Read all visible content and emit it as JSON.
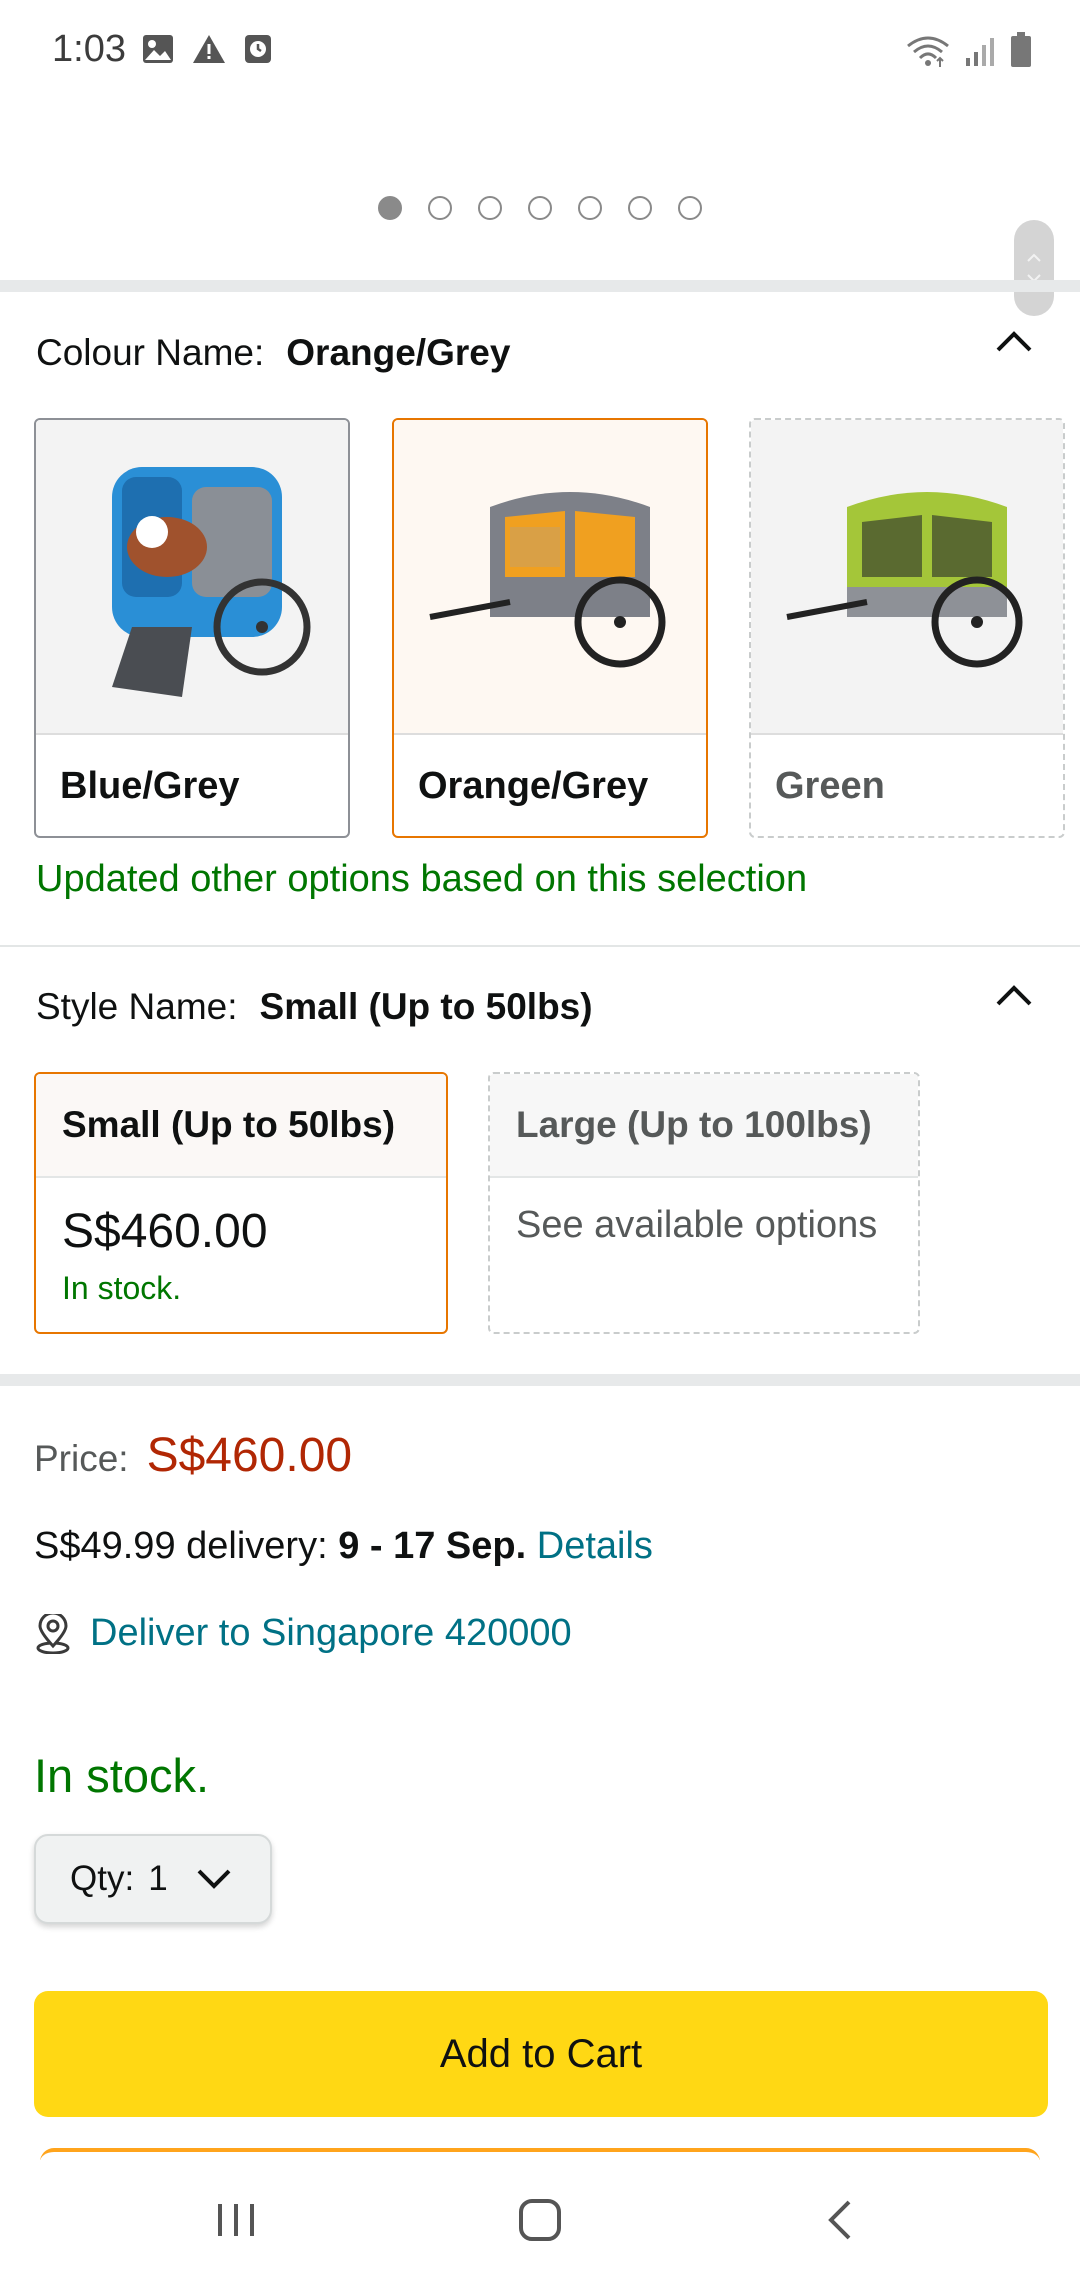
{
  "status_bar": {
    "time": "1:03",
    "left_icons": [
      "gallery-icon",
      "warning-icon",
      "alarm-icon"
    ],
    "right_icons": [
      "wifi-icon",
      "signal-icon",
      "battery-icon"
    ]
  },
  "carousel": {
    "dot_count": 7,
    "active_index": 0
  },
  "colour": {
    "label": "Colour Name:",
    "selected": "Orange/Grey",
    "options": [
      {
        "label": "Blue/Grey",
        "state": "available"
      },
      {
        "label": "Orange/Grey",
        "state": "selected"
      },
      {
        "label": "Green",
        "state": "unavailable"
      }
    ],
    "note": "Updated other options based on this selection"
  },
  "style": {
    "label": "Style Name:",
    "selected": "Small (Up to 50lbs)",
    "options": [
      {
        "label": "Small (Up to 50lbs)",
        "price": "S$460.00",
        "stock": "In stock."
      },
      {
        "label": "Large (Up to 100lbs)",
        "availability": "See available options"
      }
    ]
  },
  "price": {
    "label": "Price:",
    "value": "S$460.00"
  },
  "delivery": {
    "prefix": "S$49.99 delivery:",
    "dates": "9 - 17 Sep.",
    "details_link": "Details"
  },
  "deliver_to": "Deliver to Singapore 420000",
  "stock_status": "In stock.",
  "quantity": {
    "label": "Qty:",
    "value": "1"
  },
  "add_to_cart": "Add to Cart",
  "colors": {
    "accent_orange": "#e77600",
    "cart_yellow": "#ffd814",
    "price_red": "#b12704",
    "stock_green": "#007600",
    "link_teal": "#007185"
  }
}
